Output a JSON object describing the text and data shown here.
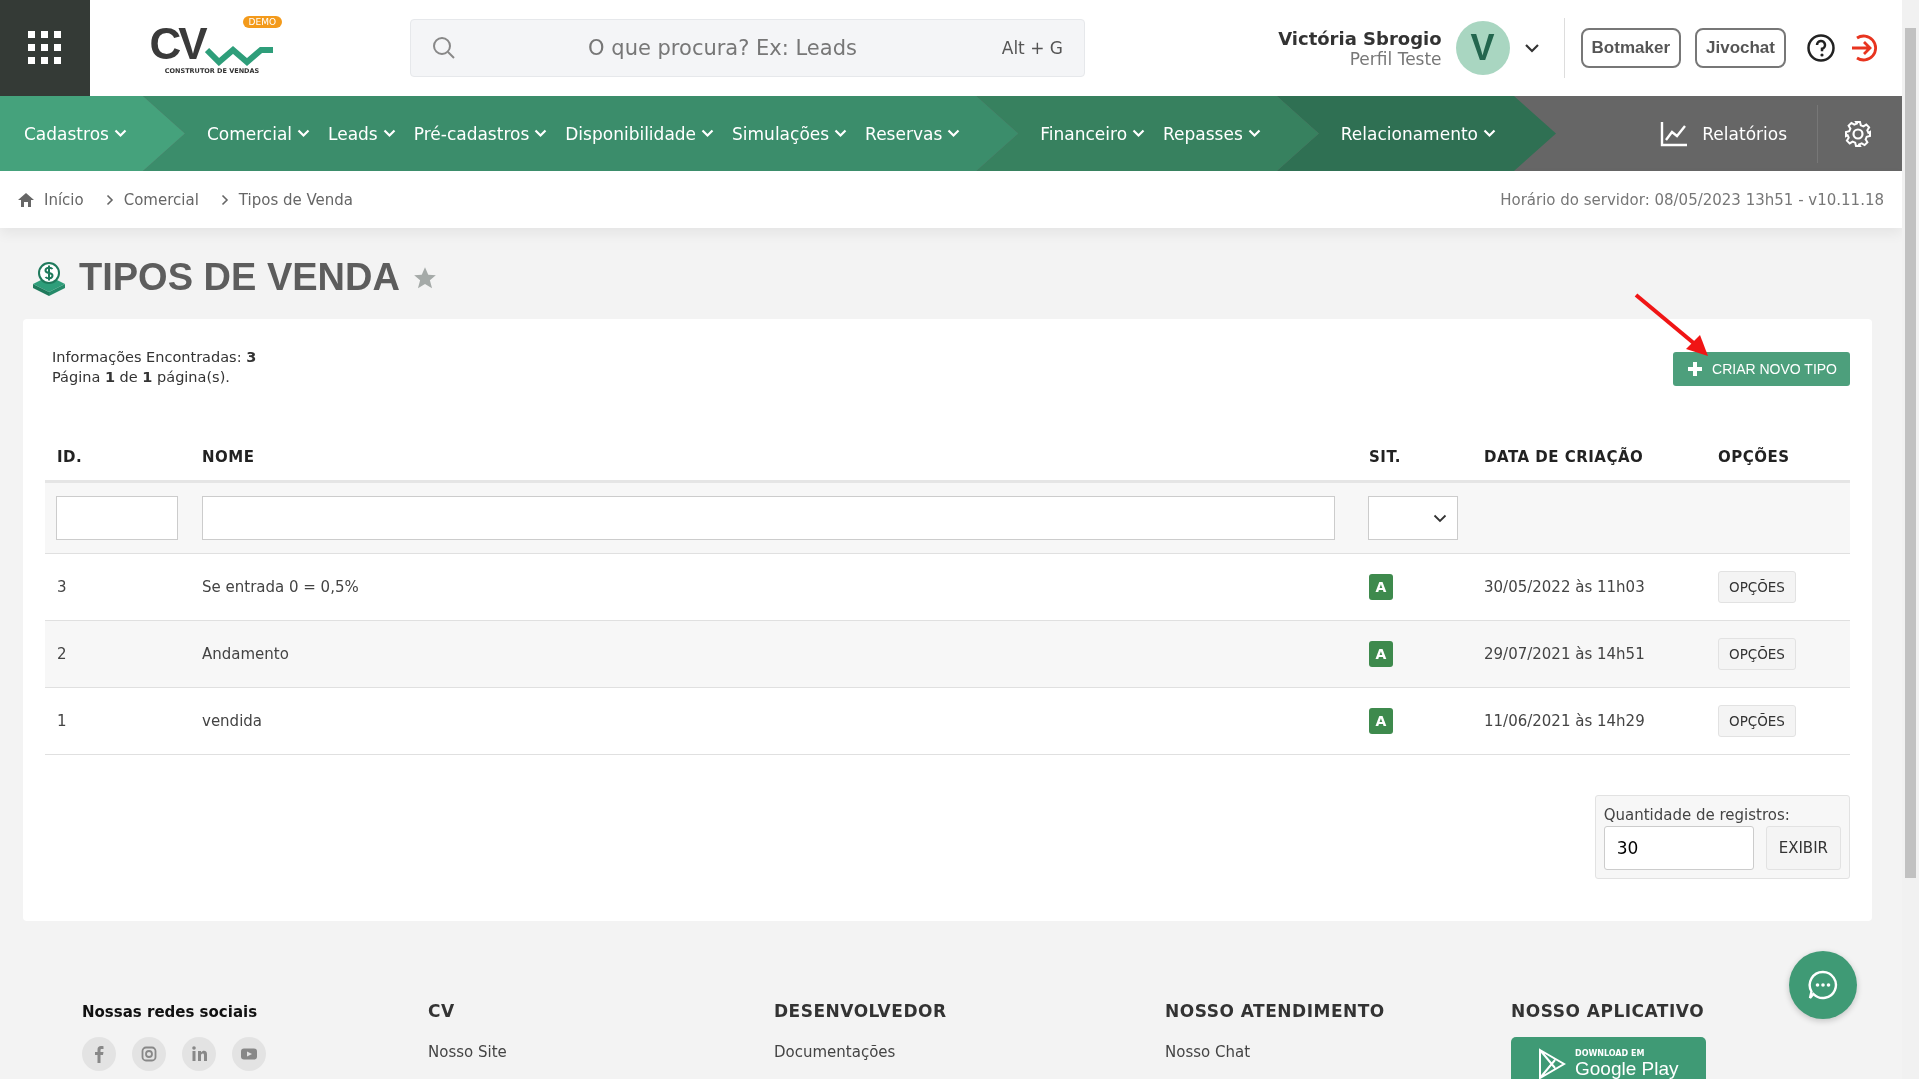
{
  "header": {
    "logo": {
      "letters": "CV",
      "badge": "DEMO",
      "tagline": "CONSTRUTOR DE VENDAS"
    },
    "search": {
      "placeholder": "O que procura? Ex: Leads",
      "shortcut": "Alt + G"
    },
    "user": {
      "name": "Victória Sbrogio",
      "profile": "Perfil Teste",
      "initial": "V"
    },
    "buttons": [
      "Botmaker",
      "Jivochat"
    ]
  },
  "nav": {
    "groups": [
      {
        "items": [
          "Cadastros"
        ]
      },
      {
        "items": [
          "Comercial",
          "Leads",
          "Pré-cadastros",
          "Disponibilidade",
          "Simulações",
          "Reservas"
        ]
      },
      {
        "items": [
          "Financeiro",
          "Repasses"
        ]
      },
      {
        "items": [
          "Relacionamento"
        ]
      }
    ],
    "reports": "Relatórios"
  },
  "breadcrumb": [
    "Início",
    "Comercial",
    "Tipos de Venda"
  ],
  "server_time": "Horário do servidor: 08/05/2023 13h51 - v10.11.18",
  "page": {
    "title": "TIPOS DE VENDA",
    "favorite": false
  },
  "summary": {
    "found": "Informações Encontradas: **3**",
    "pages": "Página **1** de **1** página(s)."
  },
  "create_button": "CRIAR NOVO TIPO",
  "table": {
    "columns": [
      "ID.",
      "NOME",
      "SIT.",
      "DATA DE CRIAÇÃO",
      "OPÇÕES"
    ],
    "rows": [
      {
        "id": "3",
        "name": "Se entrada 0 = 0,5%",
        "status": "A",
        "created": "30/05/2022 às 11h03",
        "action": "OPÇÕES"
      },
      {
        "id": "2",
        "name": "Andamento",
        "status": "A",
        "created": "29/07/2021 às 14h51",
        "action": "OPÇÕES"
      },
      {
        "id": "1",
        "name": "vendida",
        "status": "A",
        "created": "11/06/2021 às 14h29",
        "action": "OPÇÕES"
      }
    ]
  },
  "records": {
    "label": "Quantidade de registros:",
    "value": "30",
    "button": "EXIBIR"
  },
  "footer": {
    "social_title": "Nossas redes sociais",
    "social": [
      {
        "kind": "facebook"
      },
      {
        "kind": "instagram"
      },
      {
        "kind": "linkedin"
      },
      {
        "kind": "youtube"
      }
    ],
    "columns": [
      {
        "title": "CV",
        "links": [
          "Nosso Site"
        ]
      },
      {
        "title": "DESENVOLVEDOR",
        "links": [
          "Documentações"
        ]
      },
      {
        "title": "NOSSO ATENDIMENTO",
        "links": [
          "Nosso Chat"
        ]
      },
      {
        "title": "NOSSO APLICATIVO",
        "store": {
          "small": "DOWNLOAD EM",
          "big": "Google Play"
        }
      }
    ]
  }
}
